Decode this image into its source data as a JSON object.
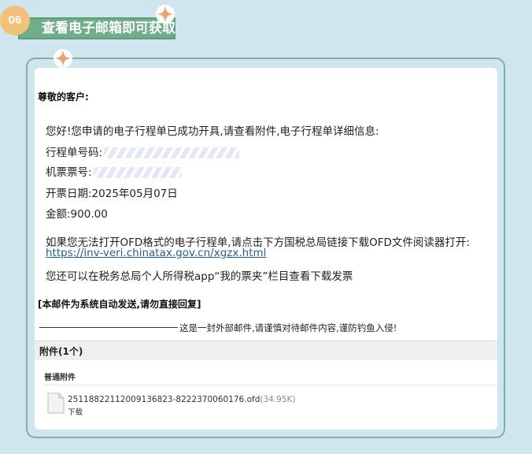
{
  "step": {
    "number": "06",
    "title": "查看电子邮箱即可获取"
  },
  "email": {
    "salutation": "尊敬的客户:",
    "intro": "您好!您申请的电子行程单已成功开具,请查看附件,电子行程单详细信息:",
    "itinerary_label": "行程单号码:",
    "ticket_label": "机票票号:",
    "issue_date": "开票日期:2025年05月07日",
    "amount": "金额:900.00",
    "ofd_notice": "如果您无法打开OFD格式的电子行程单,请点击下方国税总局链接下载OFD文件阅读器打开:",
    "ofd_link": "https://inv-veri.chinatax.gov.cn/xgzx.html",
    "app_notice": "您还可以在税务总局个人所得税app“我的票夹”栏目查看下载发票",
    "auto_notice": "[本邮件为系统自动发送,请勿直接回复]",
    "external_warning": "这是一封外部邮件,请谨慎对待邮件内容,谨防钓鱼入侵!"
  },
  "attachments": {
    "header": "附件(1个)",
    "section": "普通附件",
    "files": [
      {
        "name": "25118822112009136823-8222370060176.ofd",
        "size": "(34.95K)",
        "download": "下载"
      }
    ]
  },
  "colors": {
    "banner": "#6fae89",
    "badge": "#f2c27a",
    "frame": "#7fb39d",
    "background": "#cfe6ee",
    "sparkle": "#f0a070",
    "link": "#1f5fa0"
  }
}
